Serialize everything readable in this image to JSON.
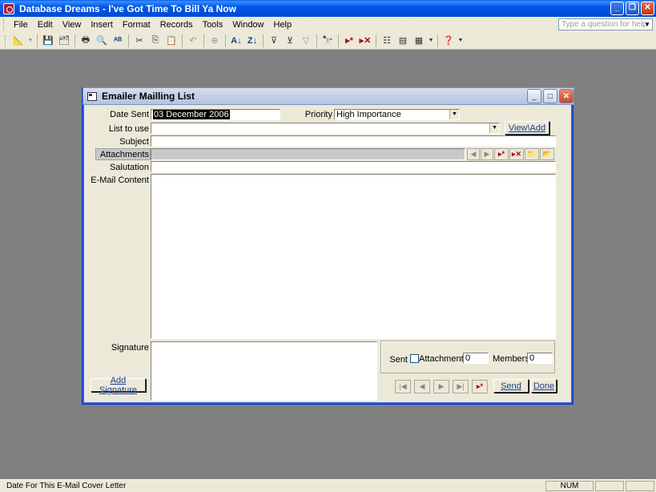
{
  "app": {
    "title": "Database Dreams - I've Got Time To Bill Ya Now"
  },
  "menubar": {
    "items": [
      "File",
      "Edit",
      "View",
      "Insert",
      "Format",
      "Records",
      "Tools",
      "Window",
      "Help"
    ],
    "question_placeholder": "Type a question for help"
  },
  "form": {
    "title": "Emailer Mailling List",
    "date_sent_label": "Date Sent",
    "date_sent_value": "03 December 2006",
    "priority_label": "Priority",
    "priority_value": "High Importance",
    "list_label": "List to use",
    "list_value": "",
    "view_add_label": "View\\Add",
    "subject_label": "Subject",
    "subject_value": "",
    "attachments_label": "Attachments",
    "salutation_label": "Salutation",
    "salutation_value": "",
    "content_label": "E-Mail Content",
    "content_value": "",
    "signature_label": "Signature",
    "signature_value": "",
    "add_signature_label": "Add Signature",
    "sent_label": "Sent",
    "attachments_count_label": "Attachments",
    "attachments_count_value": "0",
    "members_label": "Members",
    "members_value": "0",
    "send_label": "Send",
    "done_label": "Done"
  },
  "statusbar": {
    "text": "Date For This E-Mail Cover Letter",
    "num": "NUM"
  }
}
